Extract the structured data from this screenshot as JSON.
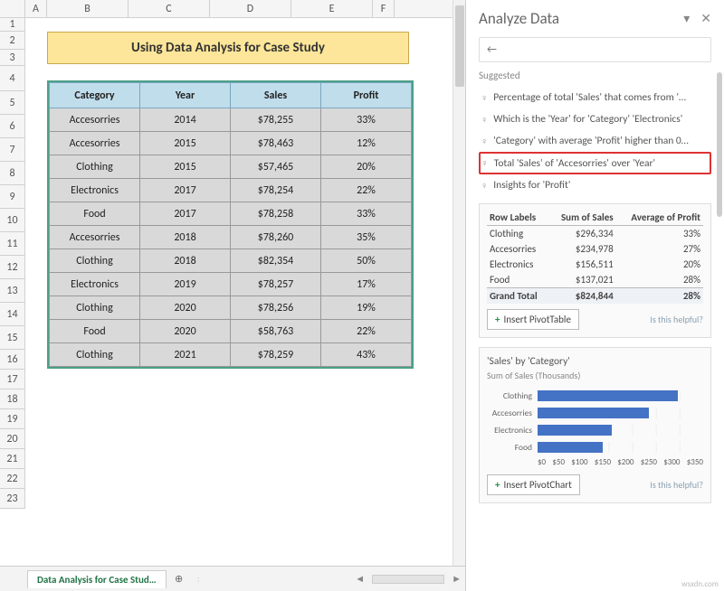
{
  "cols": [
    "A",
    "B",
    "C",
    "D",
    "E",
    "F"
  ],
  "rows": [
    "1",
    "2",
    "3",
    "4",
    "5",
    "6",
    "7",
    "8",
    "9",
    "10",
    "11",
    "12",
    "13",
    "14",
    "15",
    "16",
    "17",
    "18",
    "19",
    "20",
    "21",
    "22",
    "23"
  ],
  "sheet_title": "Using Data Analysis for Case Study",
  "table": {
    "headers": [
      "Category",
      "Year",
      "Sales",
      "Profit"
    ],
    "rows": [
      [
        "Accesorries",
        "2014",
        "$78,255",
        "33%"
      ],
      [
        "Accesorries",
        "2015",
        "$78,463",
        "12%"
      ],
      [
        "Clothing",
        "2015",
        "$57,465",
        "20%"
      ],
      [
        "Electronics",
        "2017",
        "$78,254",
        "22%"
      ],
      [
        "Food",
        "2017",
        "$78,258",
        "33%"
      ],
      [
        "Accesorries",
        "2018",
        "$78,260",
        "35%"
      ],
      [
        "Clothing",
        "2018",
        "$82,354",
        "50%"
      ],
      [
        "Electronics",
        "2019",
        "$78,257",
        "17%"
      ],
      [
        "Clothing",
        "2020",
        "$78,256",
        "19%"
      ],
      [
        "Food",
        "2020",
        "$58,763",
        "22%"
      ],
      [
        "Clothing",
        "2021",
        "$78,259",
        "43%"
      ]
    ]
  },
  "tabs": {
    "active": "Data Analysis for Case Stud…",
    "plus": "⊕",
    "sep": ":"
  },
  "pane": {
    "title": "Analyze Data",
    "back": "←",
    "suggested": "Suggested",
    "items": [
      "Percentage of total 'Sales' that comes from '…",
      "Which is the 'Year' for 'Category' 'Electronics'",
      "'Category' with average 'Profit' higher than 0…",
      "Total 'Sales' of 'Accesorries' over 'Year'",
      "Insights for 'Profit'"
    ],
    "pivot": {
      "headers": [
        "Row Labels",
        "Sum of Sales",
        "Average of Profit"
      ],
      "rows": [
        [
          "Clothing",
          "$296,334",
          "33%"
        ],
        [
          "Accesorries",
          "$234,978",
          "27%"
        ],
        [
          "Electronics",
          "$156,511",
          "20%"
        ],
        [
          "Food",
          "$137,021",
          "28%"
        ]
      ],
      "gt": [
        "Grand Total",
        "$824,844",
        "28%"
      ],
      "btn": "Insert PivotTable",
      "helpful": "Is this helpful?"
    },
    "chart": {
      "title": "'Sales' by 'Category'",
      "subtitle": "Sum of Sales (Thousands)",
      "btn": "Insert PivotChart",
      "helpful": "Is this helpful?"
    }
  },
  "chart_data": {
    "type": "bar",
    "title": "'Sales' by 'Category'",
    "subtitle": "Sum of Sales (Thousands)",
    "xlabel": "",
    "ylabel": "",
    "xlim": [
      0,
      350
    ],
    "ticks": [
      "$0",
      "$50",
      "$100",
      "$150",
      "$200",
      "$250",
      "$300",
      "$350"
    ],
    "categories": [
      "Clothing",
      "Accesorries",
      "Electronics",
      "Food"
    ],
    "values": [
      296,
      235,
      157,
      137
    ]
  },
  "watermark": "wsxdn.com"
}
